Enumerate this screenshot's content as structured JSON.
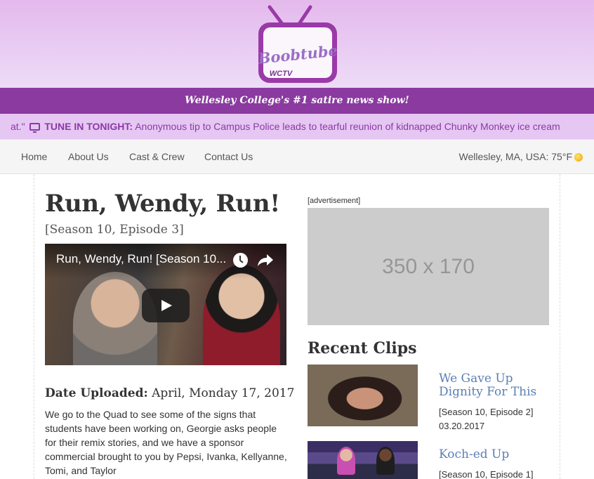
{
  "header": {
    "logo_text": "Boobtube",
    "logo_subtext": "WCTV",
    "tagline": "Wellesley College's #1 satire news show!"
  },
  "ticker": {
    "prefix": "at.\"",
    "icon": "tv-icon",
    "label": "TUNE IN TONIGHT:",
    "text": "Anonymous tip to Campus Police leads to tearful reunion of kidnapped Chunky Monkey ice cream"
  },
  "nav": {
    "items": [
      "Home",
      "About Us",
      "Cast & Crew",
      "Contact Us"
    ],
    "weather": "Wellesley, MA, USA: 75°F",
    "weather_icon": "sun-icon"
  },
  "post": {
    "title": "Run, Wendy, Run!",
    "subtitle": "[Season 10, Episode 3]",
    "video_title": "Run, Wendy, Run! [Season 10...",
    "date_label": "Date Uploaded:",
    "date_value": "April, Monday 17, 2017",
    "body": "We go to the Quad to see some of the signs that students have been working on, Georgie asks people for their remix stories, and we have a sponsor commercial brought to you by Pepsi, Ivanka, Kellyanne, Tomi, and Taylor"
  },
  "sidebar": {
    "ad_label": "[advertisement]",
    "ad_placeholder": "350 x 170",
    "recent_heading": "Recent Clips",
    "clips": [
      {
        "title": "We Gave Up Dignity For This",
        "episode": "[Season 10, Episode 2]",
        "date": "03.20.2017"
      },
      {
        "title": "Koch-ed Up",
        "episode": "[Season 10, Episode 1]",
        "date": ""
      }
    ]
  },
  "colors": {
    "header_bg": "#e4b9ec",
    "tagline_bg": "#8b3aa0",
    "ticker_bg": "#e6c6f3",
    "ticker_text": "#8a3ba4",
    "link": "#5b7fb5"
  }
}
